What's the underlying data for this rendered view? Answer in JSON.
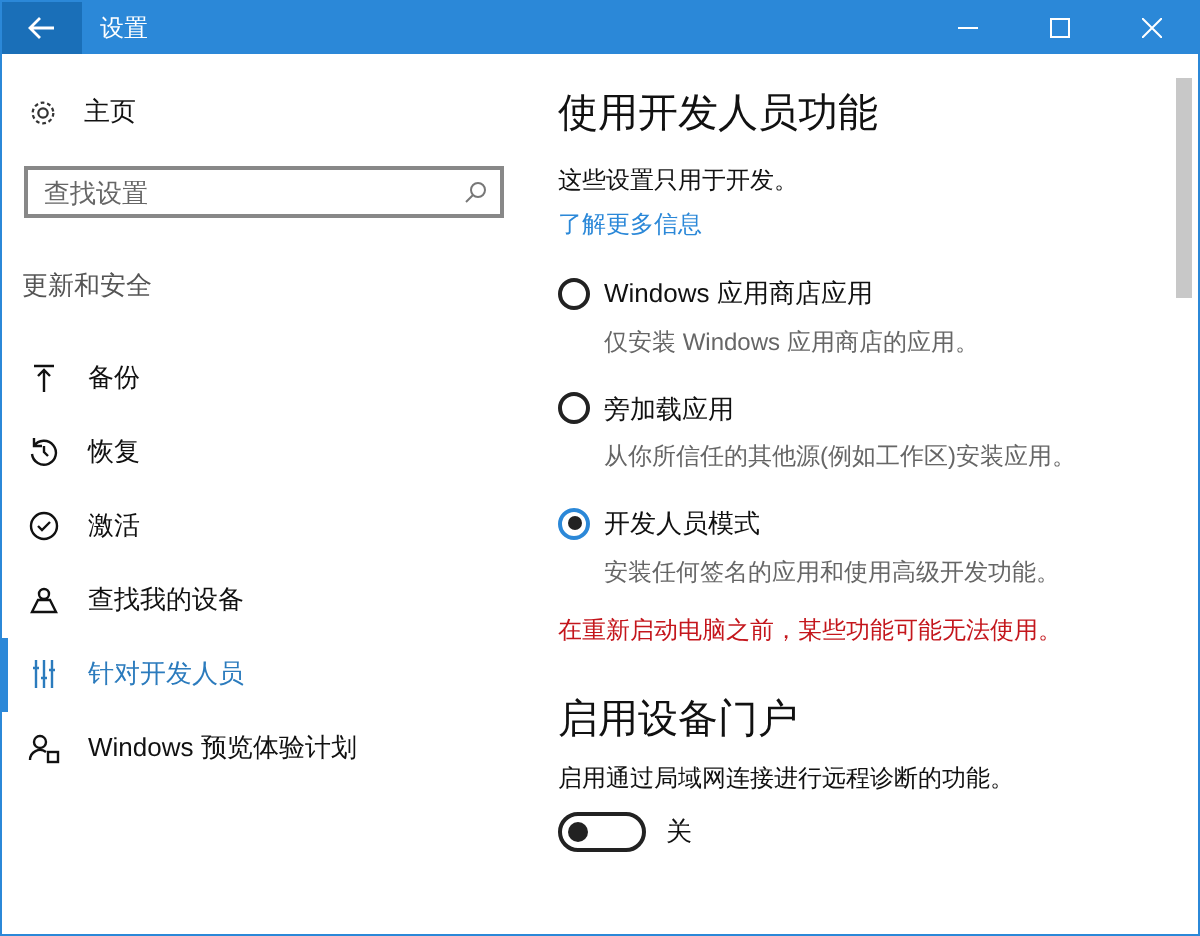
{
  "window": {
    "title": "设置"
  },
  "sidebar": {
    "home": "主页",
    "search": {
      "placeholder": "查找设置"
    },
    "section": "更新和安全",
    "items": [
      {
        "label": "备份",
        "kind": "backup",
        "selected": false
      },
      {
        "label": "恢复",
        "kind": "history",
        "selected": false
      },
      {
        "label": "激活",
        "kind": "check",
        "selected": false
      },
      {
        "label": "查找我的设备",
        "kind": "person",
        "selected": false
      },
      {
        "label": "针对开发人员",
        "kind": "sliders",
        "selected": true
      },
      {
        "label": "Windows 预览体验计划",
        "kind": "insider",
        "selected": false
      }
    ]
  },
  "content": {
    "title": "使用开发人员功能",
    "intro": "这些设置只用于开发。",
    "link": "了解更多信息",
    "options": [
      {
        "label": "Windows 应用商店应用",
        "description": "仅安装 Windows 应用商店的应用。",
        "selected": false
      },
      {
        "label": "旁加载应用",
        "description": "从你所信任的其他源(例如工作区)安装应用。",
        "selected": false
      },
      {
        "label": "开发人员模式",
        "description": "安装任何签名的应用和使用高级开发功能。",
        "selected": true
      }
    ],
    "warning": "在重新启动电脑之前，某些功能可能无法使用。",
    "portal": {
      "title": "启用设备门户",
      "description": "启用通过局域网连接进行远程诊断的功能。",
      "on": false,
      "state_label": "关"
    }
  }
}
